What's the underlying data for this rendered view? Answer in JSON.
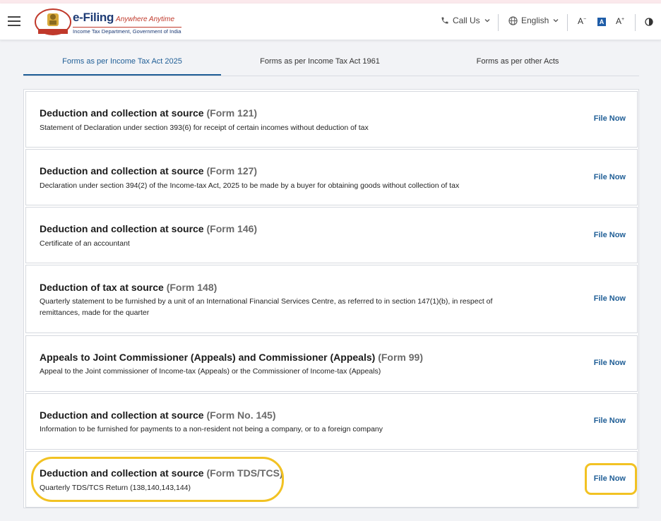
{
  "header": {
    "logo_title": "e-Filing",
    "logo_tagline": "Anywhere Anytime",
    "logo_subtitle": "Income Tax Department, Government of India",
    "call_us": "Call Us",
    "language": "English",
    "font_decrease": "A",
    "font_normal": "A",
    "font_increase": "A"
  },
  "tabs": [
    {
      "label": "Forms as per Income Tax Act 2025",
      "active": true
    },
    {
      "label": "Forms as per Income Tax Act 1961",
      "active": false
    },
    {
      "label": "Forms as per other Acts",
      "active": false
    }
  ],
  "forms": [
    {
      "title": "Deduction and collection at source",
      "code": "(Form 121)",
      "desc": "Statement of Declaration under section 393(6) for receipt of certain incomes without deduction of tax",
      "action": "File Now"
    },
    {
      "title": "Deduction and collection at source",
      "code": "(Form 127)",
      "desc": "Declaration under section 394(2) of the Income-tax Act, 2025 to be made by a buyer for obtaining goods without collection of tax",
      "action": "File Now"
    },
    {
      "title": "Deduction and collection at source",
      "code": "(Form 146)",
      "desc": "Certificate of an accountant",
      "action": "File Now"
    },
    {
      "title": "Deduction of tax at source",
      "code": "(Form 148)",
      "desc": "Quarterly statement to be furnished by a unit of an International Financial Services Centre, as referred to in section 147(1)(b), in respect of remittances, made for the quarter",
      "action": "File Now"
    },
    {
      "title": "Appeals to Joint Commissioner (Appeals) and Commissioner (Appeals)",
      "code": "(Form 99)",
      "desc": "Appeal to the Joint commissioner of Income-tax (Appeals) or the Commissioner of Income-tax (Appeals)",
      "action": "File Now"
    },
    {
      "title": "Deduction and collection at source",
      "code": "(Form No. 145)",
      "desc": "Information to be furnished for payments to a non-resident not being a company, or to a foreign company",
      "action": "File Now"
    },
    {
      "title": "Deduction and collection at source",
      "code": "(Form TDS/TCS)",
      "desc": "Quarterly TDS/TCS Return (138,140,143,144)",
      "action": "File Now"
    }
  ],
  "colors": {
    "accent": "#1f5e96",
    "highlight": "#f2c223"
  },
  "icons": [
    "hamburger-menu-icon",
    "emblem-logo-icon",
    "phone-icon",
    "chevron-down-icon",
    "globe-icon",
    "contrast-icon"
  ]
}
